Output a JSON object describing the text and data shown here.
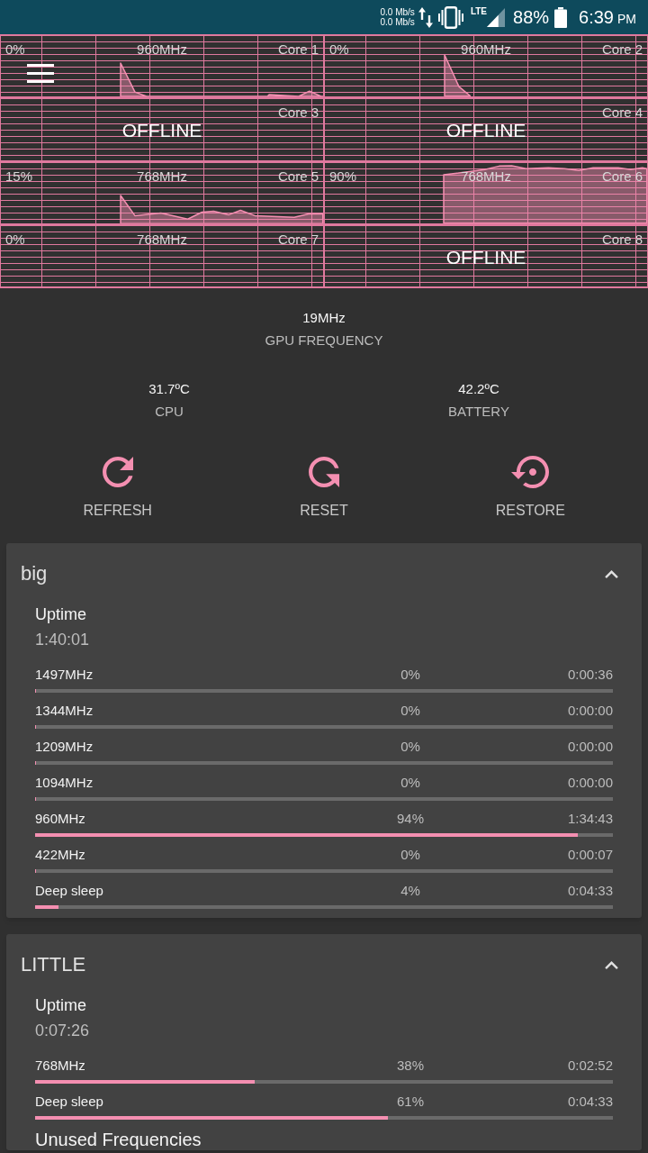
{
  "status_bar": {
    "net_speed_up": "0.0 Mb/s",
    "net_speed_down": "0.0 Mb/s",
    "network_type": "LTE",
    "battery": "88%",
    "time": "6:39",
    "time_period": "PM"
  },
  "cores": [
    {
      "kind": "online",
      "name": "Core 1",
      "usage": "0%",
      "frequency": "960MHz"
    },
    {
      "kind": "online",
      "name": "Core 2",
      "usage": "0%",
      "frequency": "960MHz"
    },
    {
      "kind": "offline",
      "name": "Core 3",
      "status": "OFFLINE"
    },
    {
      "kind": "offline",
      "name": "Core 4",
      "status": "OFFLINE"
    },
    {
      "kind": "online",
      "name": "Core 5",
      "usage": "15%",
      "frequency": "768MHz"
    },
    {
      "kind": "online",
      "name": "Core 6",
      "usage": "90%",
      "frequency": "768MHz"
    },
    {
      "kind": "online",
      "name": "Core 7",
      "usage": "0%",
      "frequency": "768MHz"
    },
    {
      "kind": "offline",
      "name": "Core 8",
      "status": "OFFLINE"
    }
  ],
  "gpu": {
    "value": "19MHz",
    "label": "GPU FREQUENCY"
  },
  "temperatures": [
    {
      "value": "31.7ºC",
      "label": "CPU"
    },
    {
      "value": "42.2ºC",
      "label": "BATTERY"
    }
  ],
  "actions": [
    {
      "kind": "refresh",
      "label": "REFRESH"
    },
    {
      "kind": "reset",
      "label": "RESET"
    },
    {
      "kind": "restore",
      "label": "RESTORE"
    }
  ],
  "clusters": [
    {
      "title": "big",
      "expanded": true,
      "uptime_label": "Uptime",
      "uptime": "1:40:01",
      "states": [
        {
          "frequency": "1497MHz",
          "percent": "0%",
          "time": "0:00:36",
          "level": 0
        },
        {
          "frequency": "1344MHz",
          "percent": "0%",
          "time": "0:00:00",
          "level": 0
        },
        {
          "frequency": "1209MHz",
          "percent": "0%",
          "time": "0:00:00",
          "level": 0
        },
        {
          "frequency": "1094MHz",
          "percent": "0%",
          "time": "0:00:00",
          "level": 0
        },
        {
          "frequency": "960MHz",
          "percent": "94%",
          "time": "1:34:43",
          "level": 0.94
        },
        {
          "frequency": "422MHz",
          "percent": "0%",
          "time": "0:00:07",
          "level": 0
        },
        {
          "frequency": "Deep sleep",
          "percent": "4%",
          "time": "0:04:33",
          "level": 0.04
        }
      ]
    },
    {
      "title": "LITTLE",
      "expanded": true,
      "uptime_label": "Uptime",
      "uptime": "0:07:26",
      "states": [
        {
          "frequency": "768MHz",
          "percent": "38%",
          "time": "0:02:52",
          "level": 0.38
        },
        {
          "frequency": "Deep sleep",
          "percent": "61%",
          "time": "0:04:33",
          "level": 0.61
        }
      ],
      "section_heading": "Unused Frequencies"
    }
  ]
}
